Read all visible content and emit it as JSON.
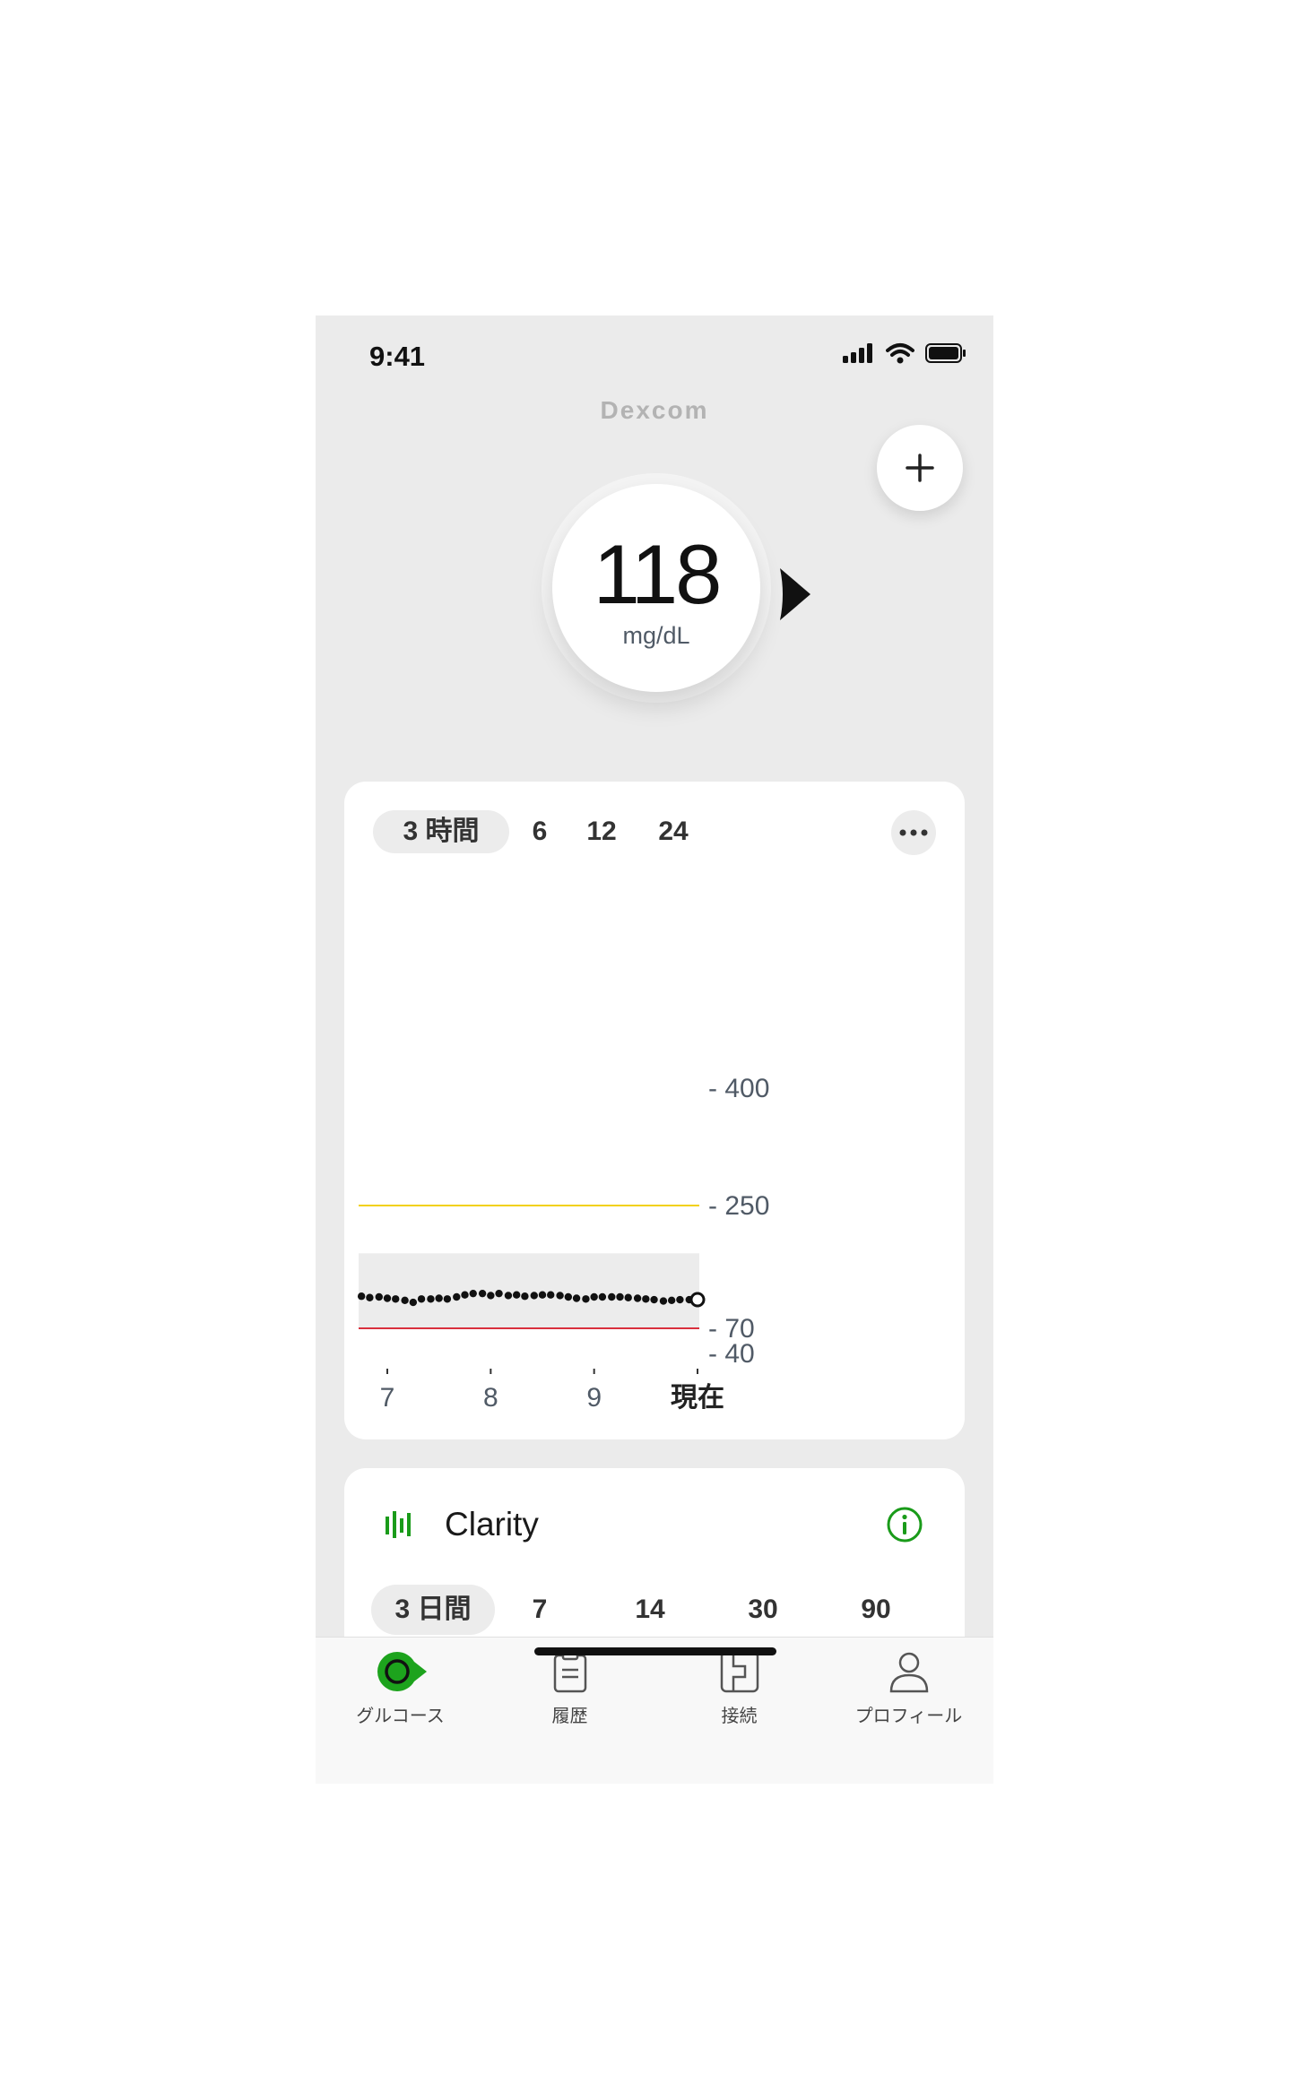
{
  "status_bar": {
    "time": "9:41"
  },
  "brand": "Dexcom",
  "reading": {
    "value": "118",
    "unit": "mg/dL",
    "trend": "steady-right-arrow"
  },
  "trend_card": {
    "tabs": [
      "3 時間",
      "6",
      "12",
      "24"
    ],
    "active_tab": 0
  },
  "chart_data": {
    "type": "scatter",
    "title": "",
    "xlabel": "",
    "ylabel": "",
    "ylim": [
      40,
      400
    ],
    "x_ticks": [
      "7",
      "8",
      "9",
      "現在"
    ],
    "y_ticks": [
      "400",
      "250",
      "70",
      "40"
    ],
    "target_range": [
      70,
      180
    ],
    "high_threshold": 250,
    "low_threshold": 70,
    "x": [
      6.75,
      6.83,
      6.92,
      7.0,
      7.08,
      7.17,
      7.25,
      7.33,
      7.42,
      7.5,
      7.58,
      7.67,
      7.75,
      7.83,
      7.92,
      8.0,
      8.08,
      8.17,
      8.25,
      8.33,
      8.42,
      8.5,
      8.58,
      8.67,
      8.75,
      8.83,
      8.92,
      9.0,
      9.08,
      9.17,
      9.25,
      9.33,
      9.42,
      9.5,
      9.58,
      9.67,
      9.75,
      9.83,
      9.92,
      10.0
    ],
    "values": [
      117,
      115,
      116,
      114,
      113,
      111,
      108,
      113,
      113,
      114,
      113,
      116,
      119,
      121,
      121,
      118,
      121,
      118,
      119,
      117,
      118,
      119,
      119,
      118,
      116,
      114,
      113,
      116,
      116,
      116,
      116,
      115,
      114,
      113,
      112,
      110,
      111,
      112,
      112,
      112
    ],
    "colors": {
      "high": "#f2d114",
      "low": "#d9303e",
      "range_band": "#ececec",
      "points": "#111111"
    }
  },
  "clarity_card": {
    "title": "Clarity",
    "tabs": [
      "3 日間",
      "7",
      "14",
      "30",
      "90"
    ],
    "active_tab": 0,
    "accent": "#1a9b1a"
  },
  "nav": {
    "items": [
      {
        "label": "グルコース",
        "icon": "glucose-icon"
      },
      {
        "label": "履歴",
        "icon": "clipboard-icon"
      },
      {
        "label": "接続",
        "icon": "connection-icon"
      },
      {
        "label": "プロフィール",
        "icon": "profile-icon"
      }
    ],
    "active": 0,
    "active_color": "#1da31d"
  }
}
